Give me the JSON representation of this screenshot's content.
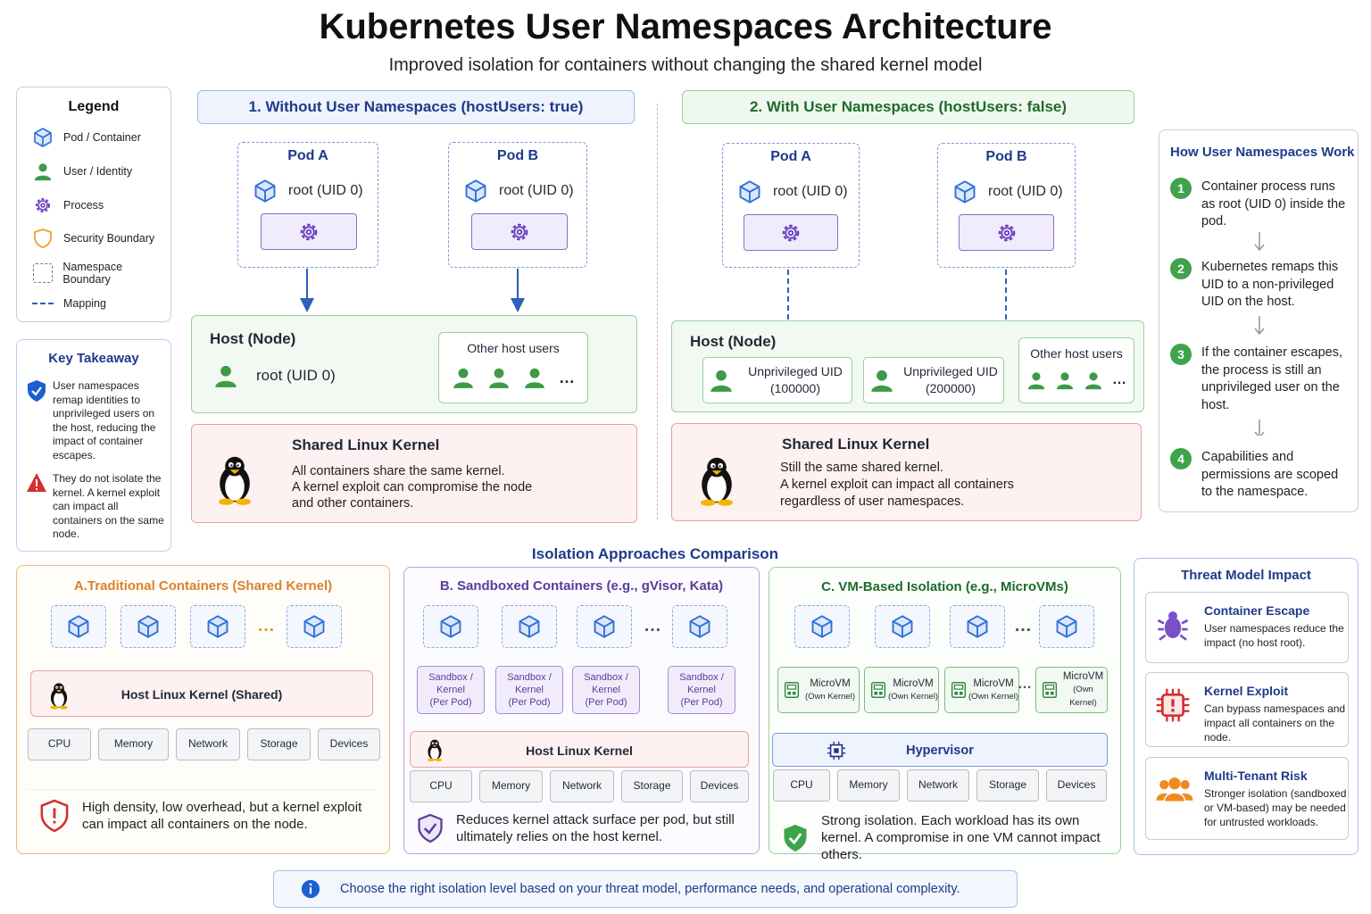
{
  "title": "Kubernetes User Namespaces Architecture",
  "subtitle": "Improved isolation for containers without changing the shared kernel model",
  "legend": {
    "title": "Legend",
    "items": [
      "Pod / Container",
      "User / Identity",
      "Process",
      "Security Boundary",
      "Namespace Boundary",
      "Mapping"
    ]
  },
  "key_takeaway": {
    "title": "Key Takeaway",
    "point1": "User namespaces remap identities to unprivileged users on the host, reducing the impact of container escapes.",
    "point2": "They do not isolate the kernel. A kernel exploit can impact all containers on the same node."
  },
  "without": {
    "header_main": "1. Without User Namespaces",
    "header_mode": "(hostUsers: true)",
    "pod_a": "Pod A",
    "pod_b": "Pod B",
    "pod_user": "root (UID 0)",
    "host_title": "Host (Node)",
    "host_user": "root (UID 0)",
    "other_users": "Other host users",
    "kernel_title": "Shared Linux Kernel",
    "kernel_desc1": "All containers share the same kernel.",
    "kernel_desc2": "A kernel exploit can compromise the node",
    "kernel_desc3": "and other containers."
  },
  "with": {
    "header_main": "2. With User Namespaces",
    "header_mode": "(hostUsers: false)",
    "pod_a": "Pod A",
    "pod_b": "Pod B",
    "pod_user": "root (UID 0)",
    "host_title": "Host (Node)",
    "unpriv_a_1": "Unprivileged UID",
    "unpriv_a_2": "(100000)",
    "unpriv_b_1": "Unprivileged UID",
    "unpriv_b_2": "(200000)",
    "other_users": "Other host users",
    "kernel_title": "Shared Linux Kernel",
    "kernel_desc1": "Still the same shared kernel.",
    "kernel_desc2": "A kernel exploit can impact all containers",
    "kernel_desc3": "regardless of user namespaces."
  },
  "how": {
    "title": "How User Namespaces Work",
    "steps": [
      {
        "num": "1",
        "text": "Container process runs as root (UID 0) inside the pod."
      },
      {
        "num": "2",
        "text": "Kubernetes remaps this UID to a non-privileged UID on the host."
      },
      {
        "num": "3",
        "text": "If the container escapes, the process is still an unprivileged user on the host."
      },
      {
        "num": "4",
        "text": "Capabilities and permissions are scoped to the namespace."
      }
    ]
  },
  "iso_title": "Isolation Approaches Comparison",
  "panel_a": {
    "title": "A.Traditional Containers (Shared Kernel)",
    "kernel": "Host Linux Kernel (Shared)",
    "note": "High density, low overhead, but a kernel exploit can impact all containers on the node."
  },
  "panel_b": {
    "title": "B. Sandboxed Containers (e.g., gVisor, Kata)",
    "sandbox_1": "Sandbox /",
    "sandbox_2": "Kernel",
    "sandbox_3": "(Per Pod)",
    "kernel": "Host Linux Kernel",
    "note": "Reduces kernel attack surface per pod, but still ultimately relies on the host kernel."
  },
  "panel_c": {
    "title": "C. VM-Based Isolation (e.g., MicroVMs)",
    "vm_1": "MicroVM",
    "vm_2": "(Own Kernel)",
    "hypervisor": "Hypervisor",
    "note": "Strong isolation. Each workload has its own kernel. A compromise in one VM cannot impact others."
  },
  "hardware": [
    "CPU",
    "Memory",
    "Network",
    "Storage",
    "Devices"
  ],
  "ellipsis": "…",
  "threat": {
    "title": "Threat Model Impact",
    "cards": [
      {
        "title": "Container Escape",
        "desc": "User namespaces reduce the impact (no host root)."
      },
      {
        "title": "Kernel Exploit",
        "desc": "Can bypass namespaces and impact all containers on the node."
      },
      {
        "title": "Multi-Tenant Risk",
        "desc": "Stronger isolation (sandboxed or VM-based) may be needed for untrusted workloads."
      }
    ]
  },
  "footer": "Choose the right isolation level based on your threat model, performance needs, and operational complexity."
}
